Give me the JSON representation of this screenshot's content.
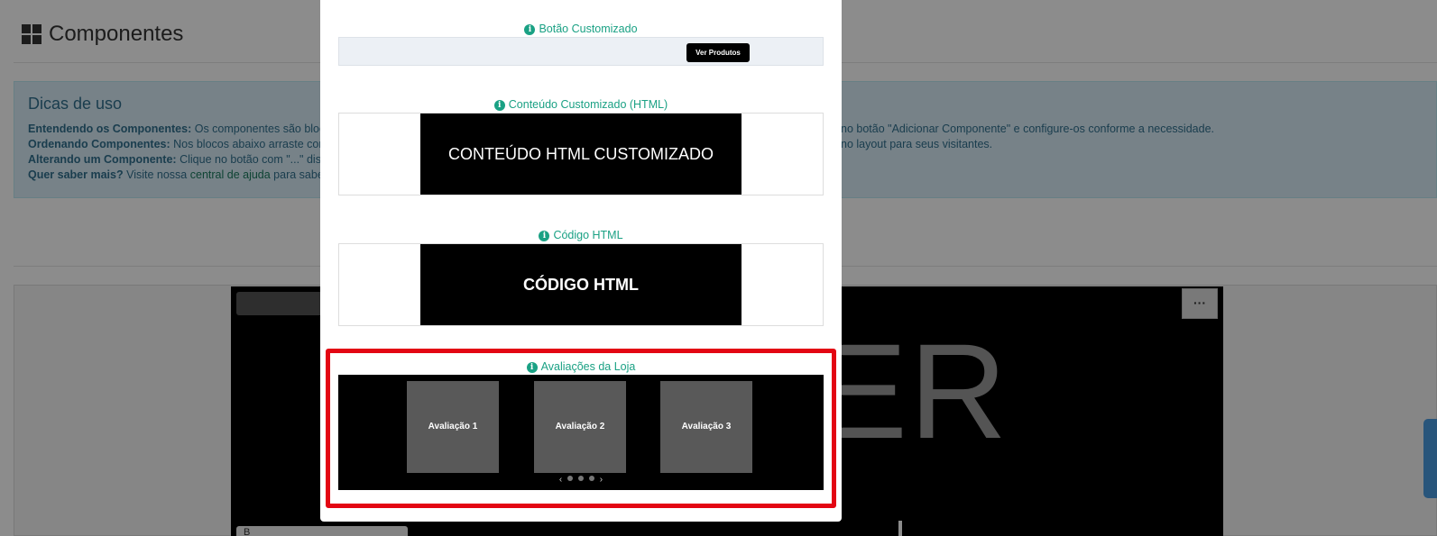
{
  "page": {
    "title": "Componentes",
    "tips": {
      "heading": "Dicas de uso",
      "lines": [
        {
          "label": "Entendendo os Componentes:",
          "text": "Os componentes são bloc",
          "right": "no botão \"Adicionar Componente\" e configure-os conforme a necessidade."
        },
        {
          "label": "Ordenando Componentes:",
          "text": "Nos blocos abaixo arraste cor",
          "right": "no layout para seus visitantes."
        },
        {
          "label": "Alterando um Componente:",
          "text": "Clique no botão com \"...\" dis",
          "right": ""
        },
        {
          "label": "Quer saber mais?",
          "text": "Visite nossa ",
          "link": "central de ajuda",
          "after": " para saber",
          "right": ""
        }
      ]
    },
    "banner_text": "ER",
    "more_button": "···",
    "bottom_label": "B"
  },
  "modal": {
    "components": [
      {
        "title": "Botão Customizado",
        "preview_button": "Ver Produtos"
      },
      {
        "title": "Conteúdo Customizado (HTML)",
        "preview_text": "CONTEÚDO HTML CUSTOMIZADO"
      },
      {
        "title": "Código HTML",
        "preview_text": "CÓDIGO HTML"
      },
      {
        "title": "Avaliações da Loja",
        "reviews": [
          "Avaliação 1",
          "Avaliação 2",
          "Avaliação 3"
        ],
        "pager_prev": "‹",
        "pager_next": "›"
      }
    ]
  },
  "colors": {
    "accent": "#1aa184",
    "highlight": "#e30613",
    "tips_bg": "#d9edf7"
  },
  "icons": {
    "grid": "grid-icon",
    "info": "info-icon"
  }
}
